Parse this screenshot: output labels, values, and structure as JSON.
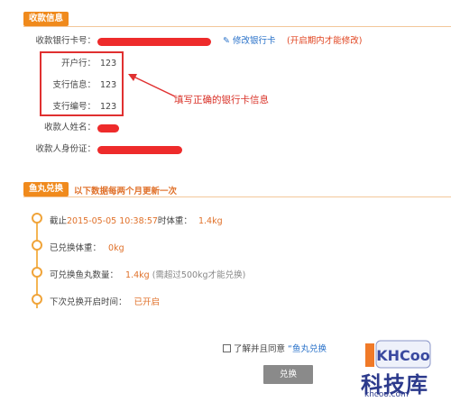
{
  "receipt": {
    "section_title": "收款信息",
    "bank_card_label": "收款银行卡号：",
    "edit_card_link": "修改银行卡",
    "edit_note": "(开启期内才能修改)",
    "bank_label": "开户行：",
    "bank_value": "123",
    "branch_info_label": "支行信息：",
    "branch_info_value": "123",
    "branch_code_label": "支行编号：",
    "branch_code_value": "123",
    "name_label": "收款人姓名：",
    "id_label": "收款人身份证："
  },
  "annotation": {
    "text": "填写正确的银行卡信息"
  },
  "exchange": {
    "section_title": "鱼丸兑换",
    "subtitle": "以下数据每两个月更新一次",
    "weight_prefix": "截止",
    "weight_date": "2015-05-05 10:38:57",
    "weight_mid": "时体重：",
    "weight_value": "1.4kg",
    "exchanged_label": "已兑换体重：",
    "exchanged_value": "0kg",
    "available_label": "可兑换鱼丸数量：",
    "available_value": "1.4kg",
    "available_note": "(需超过500kg才能兑换)",
    "next_label": "下次兑换开启时间：",
    "next_value": "已开启"
  },
  "footer": {
    "agree_text": "了解并且同意",
    "agree_link": "“鱼丸兑换",
    "submit_label": "兑换"
  },
  "watermark": {
    "logo_text": "KHCoo",
    "brand": "科技库",
    "url": "khcoo.com"
  },
  "colors": {
    "accent": "#f08a1c",
    "link": "#2a72c9",
    "annotation": "#e03030"
  }
}
